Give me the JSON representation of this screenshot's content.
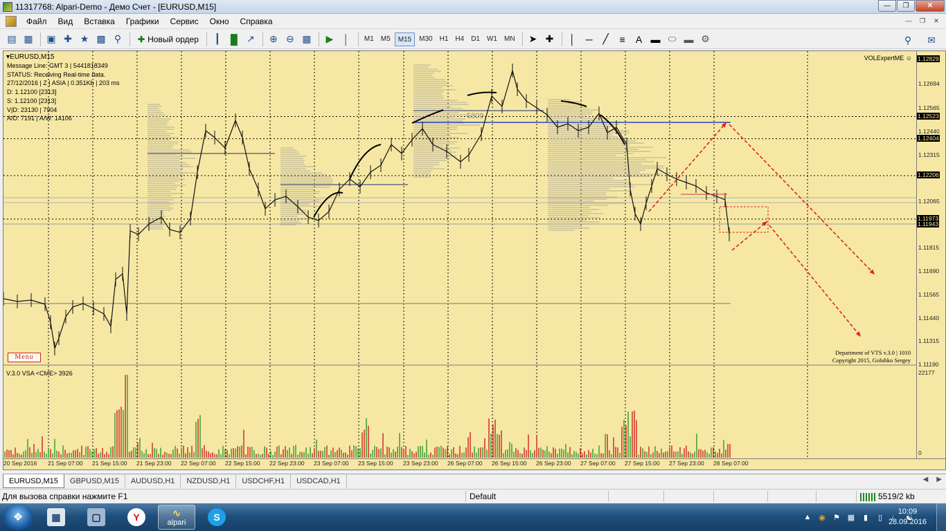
{
  "window": {
    "title": "11317768: Alpari-Demo - Демо Счет - [EURUSD,M15]"
  },
  "menu": [
    "Файл",
    "Вид",
    "Вставка",
    "Графики",
    "Сервис",
    "Окно",
    "Справка"
  ],
  "toolbar": {
    "new_order_label": "Новый ордер",
    "timeframes": [
      "M1",
      "M5",
      "M15",
      "M30",
      "H1",
      "H4",
      "D1",
      "W1",
      "MN"
    ],
    "active_timeframe": "M15",
    "text_tool": "A"
  },
  "chart": {
    "symbol_header": "EURUSD,M15",
    "info_lines": [
      "Message Line: GMT 3 | 5441818349",
      "STATUS:  Receiving Real-time data.",
      "27/12/2016 | Z | ASIA | 0.351Kb | 203 ms",
      "D: 1.12100  [2313]",
      "S: 1.12100  [2313]",
      "V|D: 23130 | 7904",
      "A/D: 7191 | A/W: 14106"
    ],
    "expert_label": "VOLExpertME",
    "menu_badge": "Menu",
    "copyright": [
      "Department of VTS  v.3.0 | 1010",
      "Copyright 2015, Golubko Sergey"
    ],
    "volume_levels": [
      "5809"
    ],
    "indicator_label": "V.3.0 VSA <CME> 3926",
    "indicator_max": "22177",
    "indicator_min": "0",
    "price_labels": [
      "1.12829",
      "1.12694",
      "1.12565",
      "1.12440",
      "1.12315",
      "1.12206",
      "1.12065",
      "1.11940",
      "1.11815",
      "1.11690",
      "1.11565",
      "1.11440",
      "1.11315",
      "1.11190"
    ],
    "price_markers": [
      "1.12829",
      "1.12523",
      "1.12404",
      "1.12206",
      "1.11973",
      "1.11943"
    ],
    "time_labels": [
      "20 Sep 2016",
      "21 Sep 07:00",
      "21 Sep 15:00",
      "21 Sep 23:00",
      "22 Sep 07:00",
      "22 Sep 15:00",
      "22 Sep 23:00",
      "23 Sep 07:00",
      "23 Sep 15:00",
      "23 Sep 23:00",
      "26 Sep 07:00",
      "26 Sep 15:00",
      "26 Sep 23:00",
      "27 Sep 07:00",
      "27 Sep 15:00",
      "27 Sep 23:00",
      "28 Sep 07:00"
    ],
    "colors": {
      "background": "#f6e8a4",
      "bull_volume": "#2a9a2a",
      "bear_volume": "#cc2222",
      "level_line": "#2244cc",
      "projection": "#dd2222"
    }
  },
  "tabs": [
    "EURUSD,M15",
    "GBPUSD,M15",
    "AUDUSD,H1",
    "NZDUSD,H1",
    "USDCHF,H1",
    "USDCAD,H1"
  ],
  "active_tab": "EURUSD,M15",
  "status": {
    "help": "Для вызова справки нажмите F1",
    "profile": "Default",
    "traffic": "5519/2 kb"
  },
  "taskbar": {
    "apps": [
      {
        "name": "calculator",
        "label": ""
      },
      {
        "name": "remote-desktop",
        "label": ""
      },
      {
        "name": "yandex",
        "label": "Y"
      },
      {
        "name": "alpari",
        "label": "alpari"
      },
      {
        "name": "skype",
        "label": "S"
      }
    ],
    "active_app": "alpari",
    "time": "10:09",
    "date": "28.09.2016"
  }
}
